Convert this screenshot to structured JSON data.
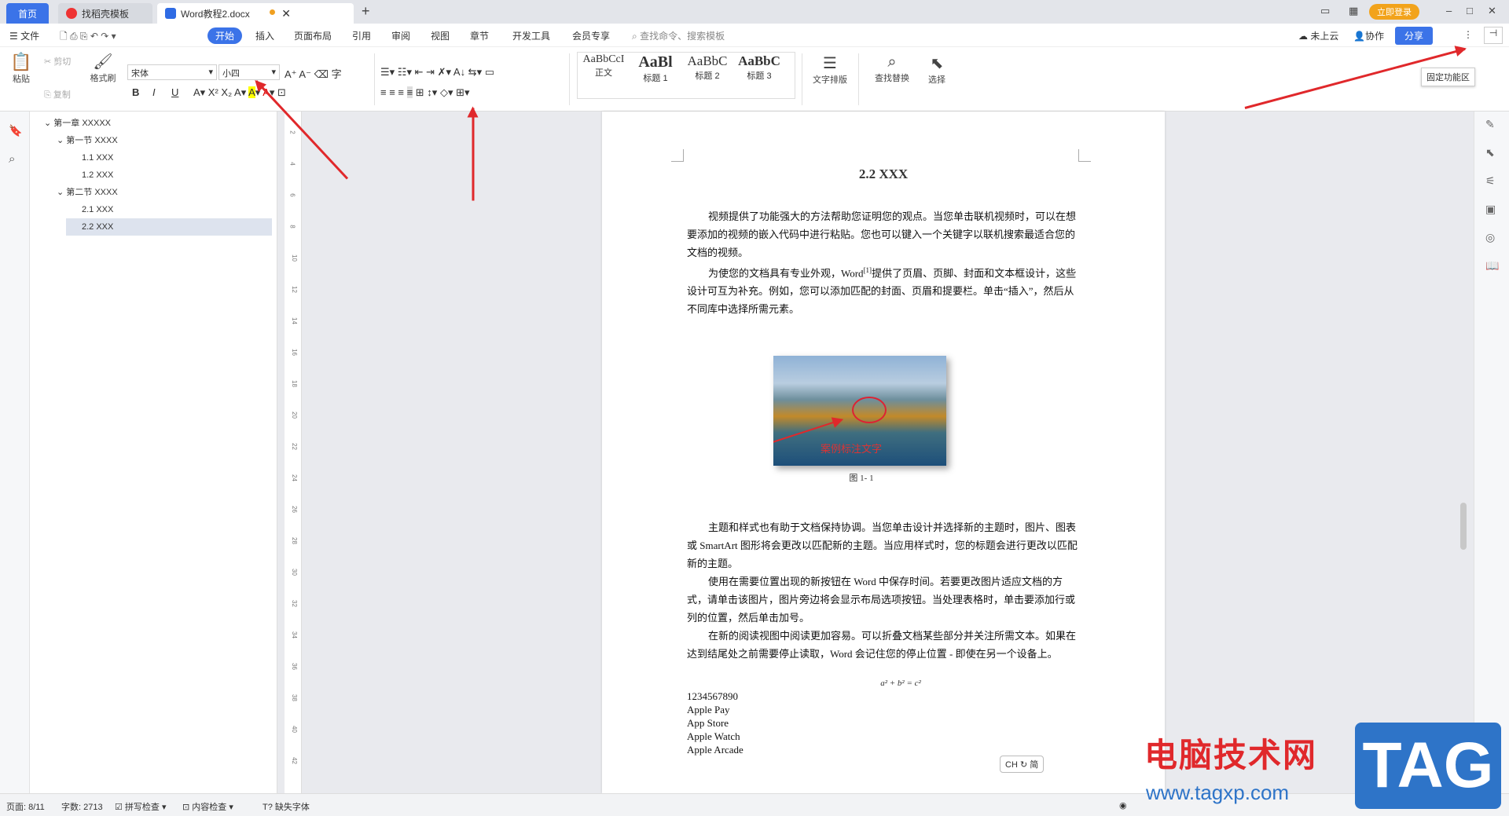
{
  "tabs": {
    "home": "首页",
    "t2": "找稻壳模板",
    "t3": "Word教程2.docx",
    "add": "+"
  },
  "topright": {
    "login": "立即登录"
  },
  "menus": {
    "file": "文件",
    "start": "开始",
    "insert": "插入",
    "layout": "页面布局",
    "ref": "引用",
    "review": "审阅",
    "view": "视图",
    "chapter": "章节",
    "dev": "开发工具",
    "vip": "会员专享",
    "search": "查找命令、搜索模板",
    "cloud": "未上云",
    "collab": "协作",
    "share": "分享"
  },
  "ribbon": {
    "paste": "粘贴",
    "cut": "剪切",
    "copy": "复制",
    "format_painter": "格式刷",
    "font": "宋体",
    "size": "小四",
    "bold": "B",
    "italic": "I",
    "underline": "U",
    "styles": [
      {
        "sample": "AaBbCcI",
        "name": "正文"
      },
      {
        "sample": "AaBl",
        "name": "标题 1"
      },
      {
        "sample": "AaBbC",
        "name": "标题 2"
      },
      {
        "sample": "AaBbC",
        "name": "标题 3"
      }
    ],
    "text_layout": "文字排版",
    "find_replace": "查找替换",
    "select": "选择",
    "tooltip": "固定功能区"
  },
  "nav": [
    {
      "label": "第一章 XXXXX"
    },
    {
      "label": "第一节 XXXX"
    },
    {
      "label": "1.1 XXX"
    },
    {
      "label": "1.2 XXX"
    },
    {
      "label": "第二节 XXXX"
    },
    {
      "label": "2.1 XXX"
    },
    {
      "label": "2.2 XXX"
    }
  ],
  "ruler": [
    "2",
    "4",
    "6",
    "8",
    "10",
    "12",
    "14",
    "16",
    "18",
    "20",
    "22",
    "24",
    "26",
    "28",
    "30",
    "32",
    "34",
    "36",
    "38",
    "40",
    "42"
  ],
  "doc": {
    "heading": "2.2 XXX",
    "p1": "视频提供了功能强大的方法帮助您证明您的观点。当您单击联机视频时，可以在想要添加的视频的嵌入代码中进行粘贴。您也可以键入一个关键字以联机搜索最适合您的文档的视频。",
    "p2a": "为使您的文档具有专业外观，Word",
    "p2sup": "[1]",
    "p2b": "提供了页眉、页脚、封面和文本框设计，这些设计可互为补充。例如，您可以添加匹配的封面、页眉和提要栏。单击“插入”，然后从不同库中选择所需元素。",
    "img_text": "案例标注文字",
    "caption": "图 1- 1",
    "p3": "主题和样式也有助于文档保持协调。当您单击设计并选择新的主题时，图片、图表或 SmartArt 图形将会更改以匹配新的主题。当应用样式时，您的标题会进行更改以匹配新的主题。",
    "p4": "使用在需要位置出现的新按钮在 Word 中保存时间。若要更改图片适应文档的方式，请单击该图片，图片旁边将会显示布局选项按钮。当处理表格时，单击要添加行或列的位置，然后单击加号。",
    "p5": "在新的阅读视图中阅读更加容易。可以折叠文档某些部分并关注所需文本。如果在达到结尾处之前需要停止读取，Word 会记住您的停止位置 - 即使在另一个设备上。",
    "formula": "a² + b² = c²",
    "lines": [
      "1234567890",
      "Apple Pay",
      "App Store",
      "Apple Watch",
      "Apple Arcade"
    ],
    "ime": "CH ↻ 简"
  },
  "status": {
    "page": "页面: 8/11",
    "words": "字数: 2713",
    "spell": "拼写检查",
    "content": "内容检查",
    "missing_font": "缺失字体"
  },
  "watermark": {
    "title": "电脑技术网",
    "url": "www.tagxp.com",
    "tag": "TAG"
  }
}
